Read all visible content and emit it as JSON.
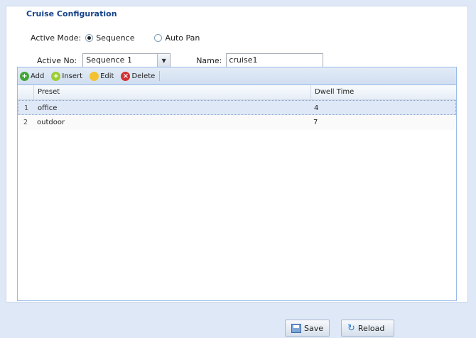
{
  "panel": {
    "title": "Cruise Configuration"
  },
  "mode": {
    "label": "Active Mode:",
    "options": [
      {
        "label": "Sequence",
        "selected": true
      },
      {
        "label": "Auto Pan",
        "selected": false
      }
    ]
  },
  "active_no": {
    "label": "Active No:",
    "value": "Sequence 1"
  },
  "name": {
    "label": "Name:",
    "value": "cruise1"
  },
  "toolbar": {
    "add": "Add",
    "insert": "Insert",
    "edit": "Edit",
    "delete": "Delete"
  },
  "grid": {
    "columns": [
      "Preset",
      "Dwell Time"
    ],
    "rows": [
      {
        "num": "1",
        "preset": "office",
        "dwell": "4"
      },
      {
        "num": "2",
        "preset": "outdoor",
        "dwell": "7"
      }
    ]
  },
  "footer": {
    "save": "Save",
    "reload": "Reload"
  },
  "colors": {
    "accent": "#15428b",
    "background": "#dfe8f6",
    "grid_border": "#99bbe8"
  }
}
